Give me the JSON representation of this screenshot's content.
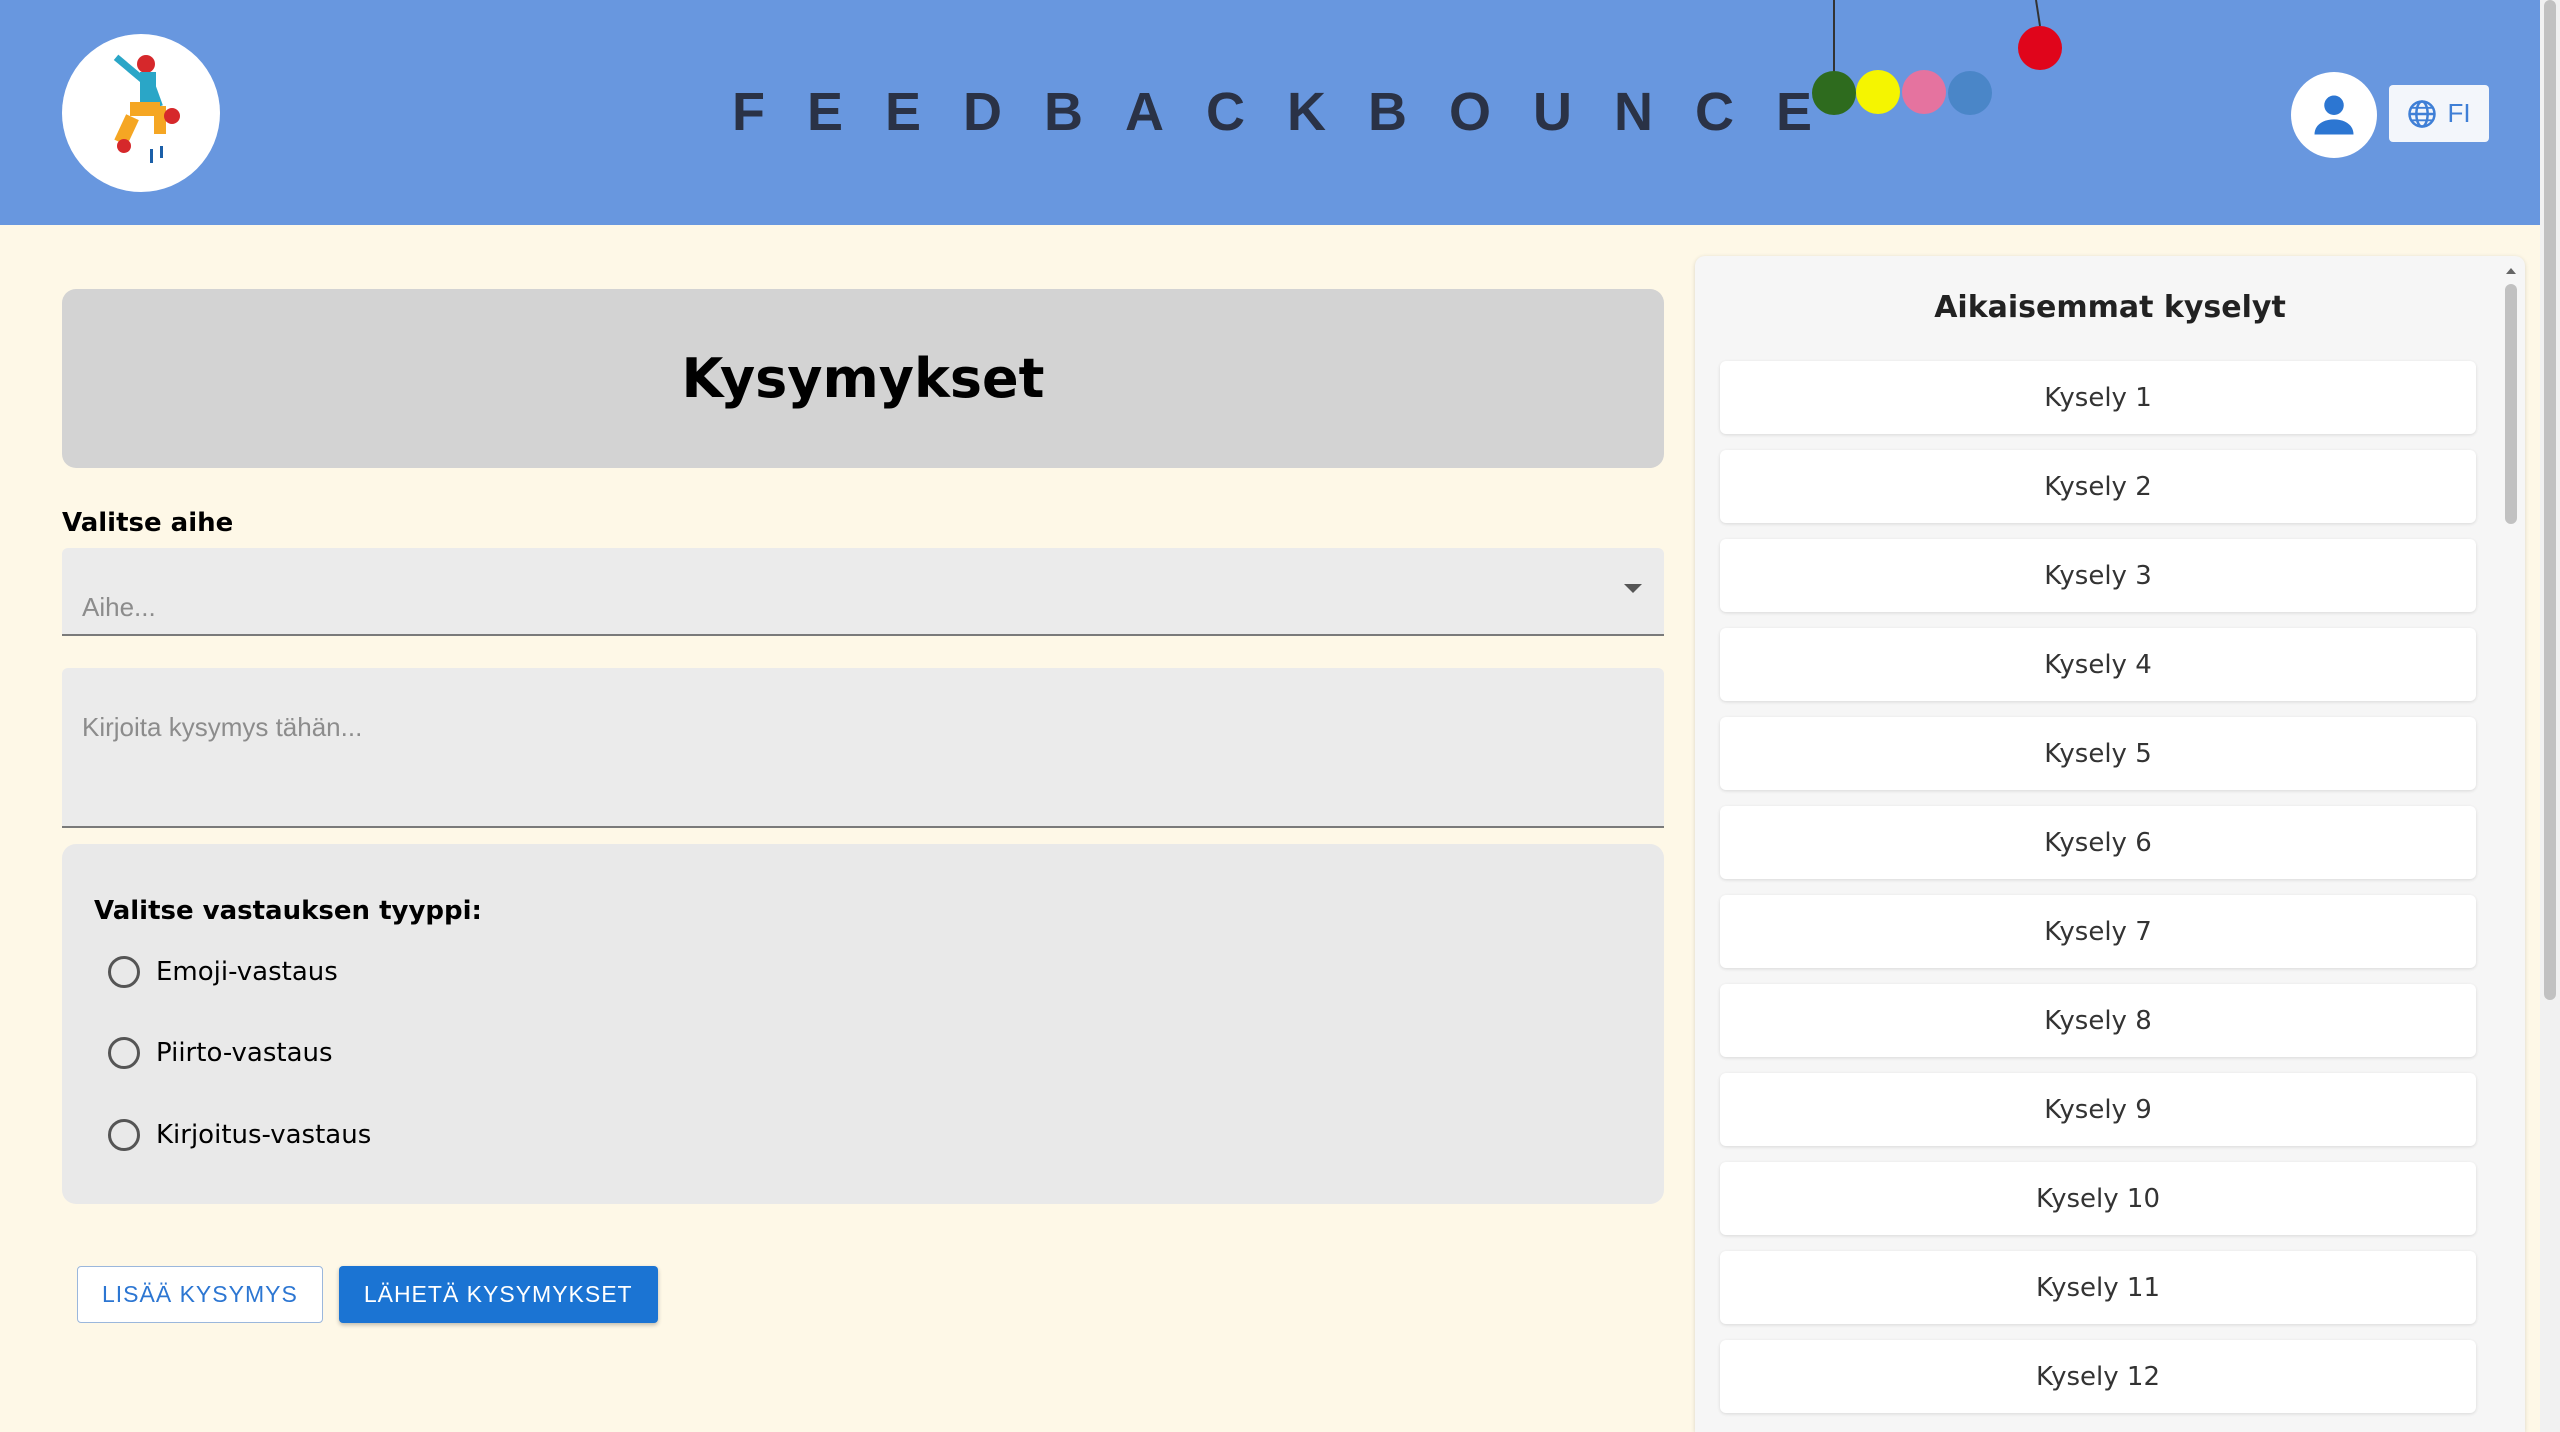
{
  "header": {
    "title": "FEEDBACKBOUNCE",
    "language_label": "FI",
    "icons": {
      "logo": "jumping-figure-logo",
      "avatar": "user-icon",
      "language": "globe-icon"
    },
    "colors": {
      "background": "#6897df",
      "balls": [
        "#2e6b1e",
        "#f5f500",
        "#e5739f",
        "#4a86c8",
        "#e0051b"
      ]
    }
  },
  "main": {
    "heading": "Kysymykset",
    "topic_label": "Valitse aihe",
    "topic_placeholder": "Aihe...",
    "question_placeholder": "Kirjoita kysymys tähän...",
    "answer_type_label": "Valitse vastauksen tyyppi:",
    "answer_types": [
      "Emoji-vastaus",
      "Piirto-vastaus",
      "Kirjoitus-vastaus"
    ],
    "add_button": "LISÄÄ KYSYMYS",
    "send_button": "LÄHETÄ KYSYMYKSET"
  },
  "sidebar": {
    "title": "Aikaisemmat kyselyt",
    "items": [
      "Kysely 1",
      "Kysely 2",
      "Kysely 3",
      "Kysely 4",
      "Kysely 5",
      "Kysely 6",
      "Kysely 7",
      "Kysely 8",
      "Kysely 9",
      "Kysely 10",
      "Kysely 11",
      "Kysely 12"
    ]
  }
}
